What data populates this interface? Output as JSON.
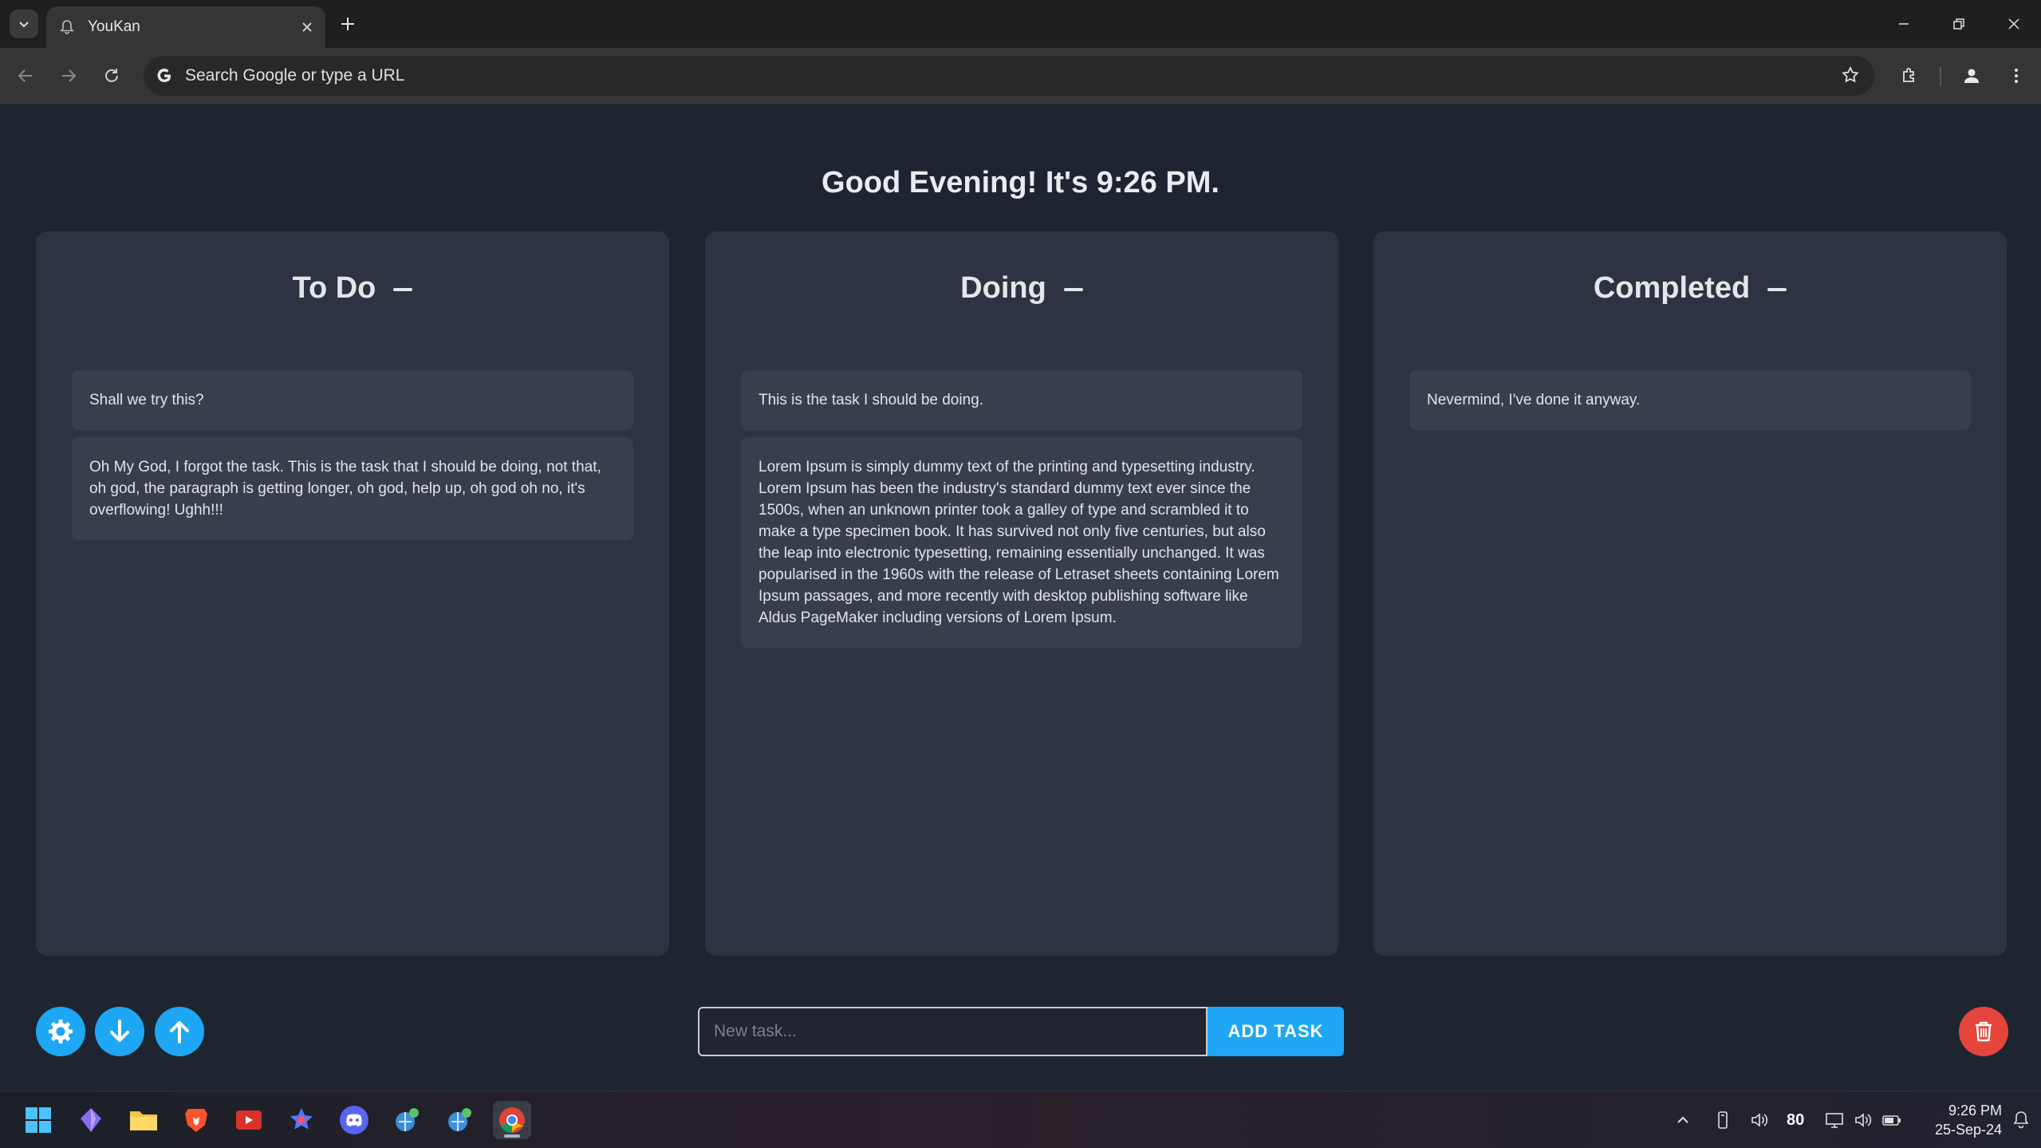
{
  "browser": {
    "tab_title": "YouKan",
    "omnibox_placeholder": "Search Google or type a URL"
  },
  "app": {
    "greeting": "Good Evening! It's 9:26 PM.",
    "columns": [
      {
        "title": "To Do",
        "tasks": [
          "Shall we try this?",
          "Oh My God, I forgot the task. This is the task that I should be doing, not that, oh god, the paragraph is getting longer, oh god, help up, oh god oh no, it's overflowing! Ughh!!!"
        ]
      },
      {
        "title": "Doing",
        "tasks": [
          "This is the task I should be doing.",
          "Lorem Ipsum is simply dummy text of the printing and typesetting industry. Lorem Ipsum has been the industry's standard dummy text ever since the 1500s, when an unknown printer took a galley of type and scrambled it to make a type specimen book. It has survived not only five centuries, but also the leap into electronic typesetting, remaining essentially unchanged. It was popularised in the 1960s with the release of Letraset sheets containing Lorem Ipsum passages, and more recently with desktop publishing software like Aldus PageMaker including versions of Lorem Ipsum."
        ]
      },
      {
        "title": "Completed",
        "tasks": [
          "Nevermind, I've done it anyway."
        ]
      }
    ],
    "new_task_placeholder": "New task...",
    "add_task_label": "ADD TASK",
    "accent_color": "#1ea7f5",
    "delete_color": "#e5453b",
    "icons": [
      "gear-icon",
      "download-icon",
      "upload-icon",
      "trash-icon"
    ]
  },
  "taskbar": {
    "tray_value": "80",
    "time": "9:26 PM",
    "date": "25-Sep-24",
    "apps": [
      "start-icon",
      "obsidian-icon",
      "file-explorer-icon",
      "brave-icon",
      "youtube-icon",
      "app-icon",
      "discord-icon",
      "app-icon",
      "app-icon",
      "chrome-icon"
    ]
  }
}
